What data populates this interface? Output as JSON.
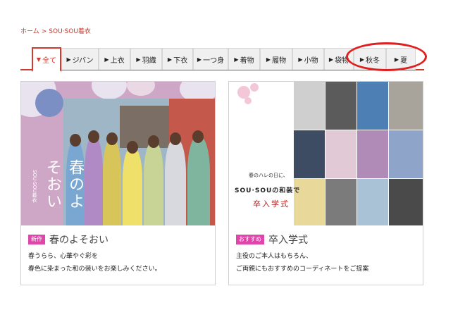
{
  "breadcrumb": {
    "home": "ホーム",
    "sep": ">",
    "current": "SOU·SOU着衣"
  },
  "tabs": [
    {
      "label": "全て",
      "arrow": "▼",
      "active": true
    },
    {
      "label": "ジバン",
      "arrow": "▶"
    },
    {
      "label": "上衣",
      "arrow": "▶"
    },
    {
      "label": "羽織",
      "arrow": "▶"
    },
    {
      "label": "下衣",
      "arrow": "▶"
    },
    {
      "label": "一つ身",
      "arrow": "▶"
    },
    {
      "label": "着物",
      "arrow": "▶"
    },
    {
      "label": "履物",
      "arrow": "▶"
    },
    {
      "label": "小物",
      "arrow": "▶"
    },
    {
      "label": "袋物",
      "arrow": "▶"
    },
    {
      "label": "秋冬",
      "arrow": "▶"
    },
    {
      "label": "夏",
      "arrow": "▶"
    }
  ],
  "cards": [
    {
      "badge": "新作",
      "title": "春のよそおい",
      "desc1": "春うらら、心華やぐ彩を",
      "desc2": "春色に染まった和の装いをお楽しみください。",
      "image_text": "春のよそおい",
      "image_small": "SOU·SOU着衣"
    },
    {
      "badge": "おすすめ",
      "title": "卒入学式",
      "desc1": "主役のご本人はもちろん、",
      "desc2": "ご両親にもおすすめのコーディネートをご提案",
      "promo_small": "春のハレの日に、",
      "promo_brand": "SOU·SOUの和装で",
      "promo_main": "卒入学式"
    }
  ],
  "colors": {
    "accent": "#d23b2e",
    "badge": "#e046a9",
    "highlight": "#e01f1f"
  }
}
